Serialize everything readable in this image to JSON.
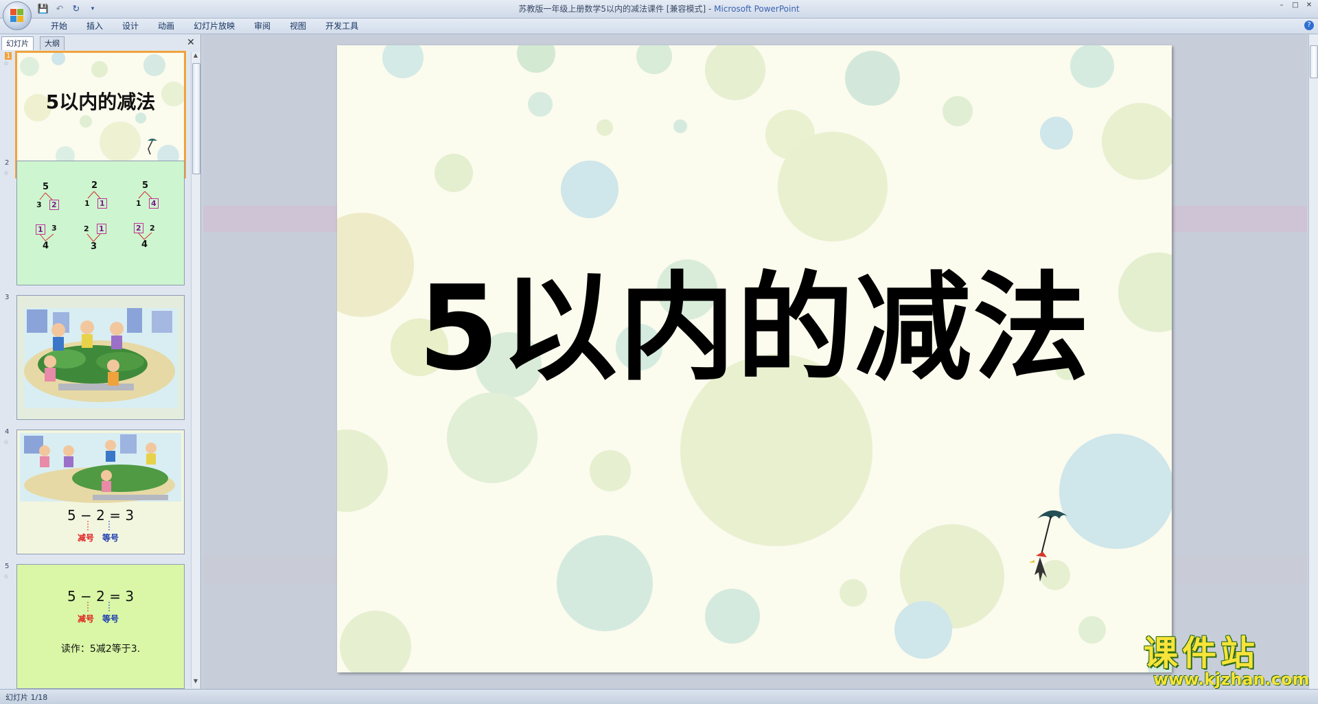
{
  "window": {
    "title_doc": "苏教版一年级上册数学5以内的减法课件 [兼容模式]",
    "title_sep": " - ",
    "title_app": "Microsoft PowerPoint"
  },
  "ribbon": {
    "tabs": [
      "开始",
      "插入",
      "设计",
      "动画",
      "幻灯片放映",
      "审阅",
      "视图",
      "开发工具"
    ]
  },
  "panel": {
    "tab_slides": "幻灯片",
    "tab_outline": "大纲"
  },
  "thumbnails": [
    {
      "num": "1",
      "title": "5以内的减法"
    },
    {
      "num": "2",
      "trees": [
        {
          "top": "5",
          "l": "3",
          "r": "2"
        },
        {
          "top": "2",
          "l": "1",
          "r": "1"
        },
        {
          "top": "5",
          "l": "1",
          "r": "4"
        },
        {
          "bot": "4",
          "l": "1",
          "r": "3"
        },
        {
          "bot": "3",
          "l": "2",
          "r": "1"
        },
        {
          "bot": "4",
          "l": "2",
          "r": "2"
        }
      ]
    },
    {
      "num": "3"
    },
    {
      "num": "4",
      "equation": "5 − 2 = 3",
      "minus_label": "减号",
      "equals_label": "等号"
    },
    {
      "num": "5",
      "equation": "5 − 2 = 3",
      "minus_label": "减号",
      "equals_label": "等号",
      "read_text": "读作：5减2等于3."
    }
  ],
  "slide": {
    "title": "5以内的减法"
  },
  "status": {
    "text": "幻灯片 1/18"
  },
  "watermark": {
    "cn": "课件站",
    "en": "www.kjzhan.com"
  },
  "colors": {
    "accent_orange": "#f0a23c",
    "slide_bg": "#fbfbee",
    "thumb2_bg": "#cdf5cf",
    "thumb5_bg": "#d9f7a6"
  }
}
